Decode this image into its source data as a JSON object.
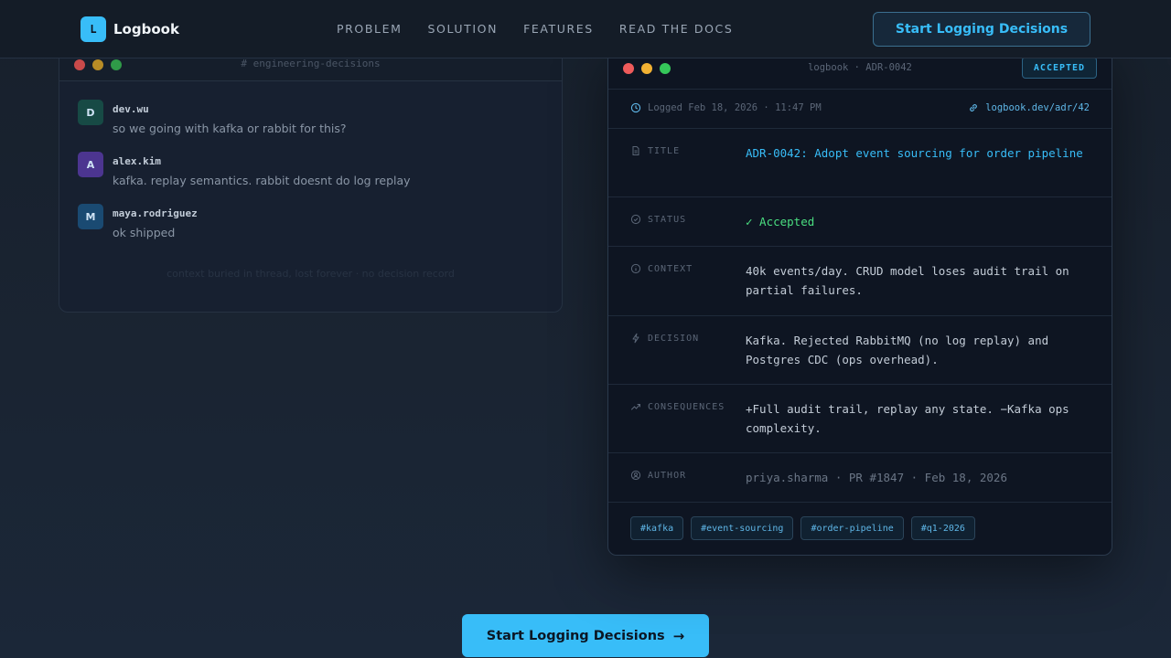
{
  "nav": {
    "brand_mark": "L",
    "brand_name": "Logbook",
    "links": [
      "PROBLEM",
      "SOLUTION",
      "FEATURES",
      "READ THE DOCS"
    ],
    "cta_label": "Start Logging Decisions"
  },
  "chat": {
    "channel": "# engineering-decisions",
    "messages": [
      {
        "initial": "D",
        "user": "dev.wu",
        "text": "so we going with kafka or rabbit for this?",
        "color": "#174a45"
      },
      {
        "initial": "A",
        "user": "alex.kim",
        "text": "kafka. replay semantics. rabbit doesnt do log replay",
        "color": "#4c3590"
      },
      {
        "initial": "M",
        "user": "maya.rodriguez",
        "text": "ok shipped",
        "color": "#1a4a72"
      }
    ],
    "footer": "context buried in thread, lost forever · no decision record"
  },
  "adr": {
    "window_title": "logbook · ADR-0042",
    "status_badge": "ACCEPTED",
    "logged": "Logged Feb 18, 2026 · 11:47 PM",
    "link": "logbook.dev/adr/42",
    "fields": {
      "title": {
        "label": "TITLE",
        "value": "ADR-0042: Adopt event sourcing for order pipeline",
        "color": "#38bdf8"
      },
      "status": {
        "label": "STATUS",
        "value": "✓ Accepted",
        "color": "#4ade80"
      },
      "context": {
        "label": "CONTEXT",
        "value": "40k events/day. CRUD model loses audit trail on partial failures."
      },
      "decision": {
        "label": "DECISION",
        "value": "Kafka. Rejected RabbitMQ (no log replay) and Postgres CDC (ops overhead)."
      },
      "consequences": {
        "label": "CONSEQUENCES",
        "value": "+Full audit trail, replay any state. −Kafka ops complexity."
      },
      "author": {
        "label": "AUTHOR",
        "value": "priya.sharma · PR #1847 · Feb 18, 2026"
      }
    },
    "tags": [
      "#kafka",
      "#event-sourcing",
      "#order-pipeline",
      "#q1-2026"
    ]
  },
  "cta": {
    "label": "Start Logging Decisions",
    "arrow": "→"
  },
  "colors": {
    "accent": "#38bdf8",
    "success": "#4ade80",
    "background": "#17202c"
  }
}
